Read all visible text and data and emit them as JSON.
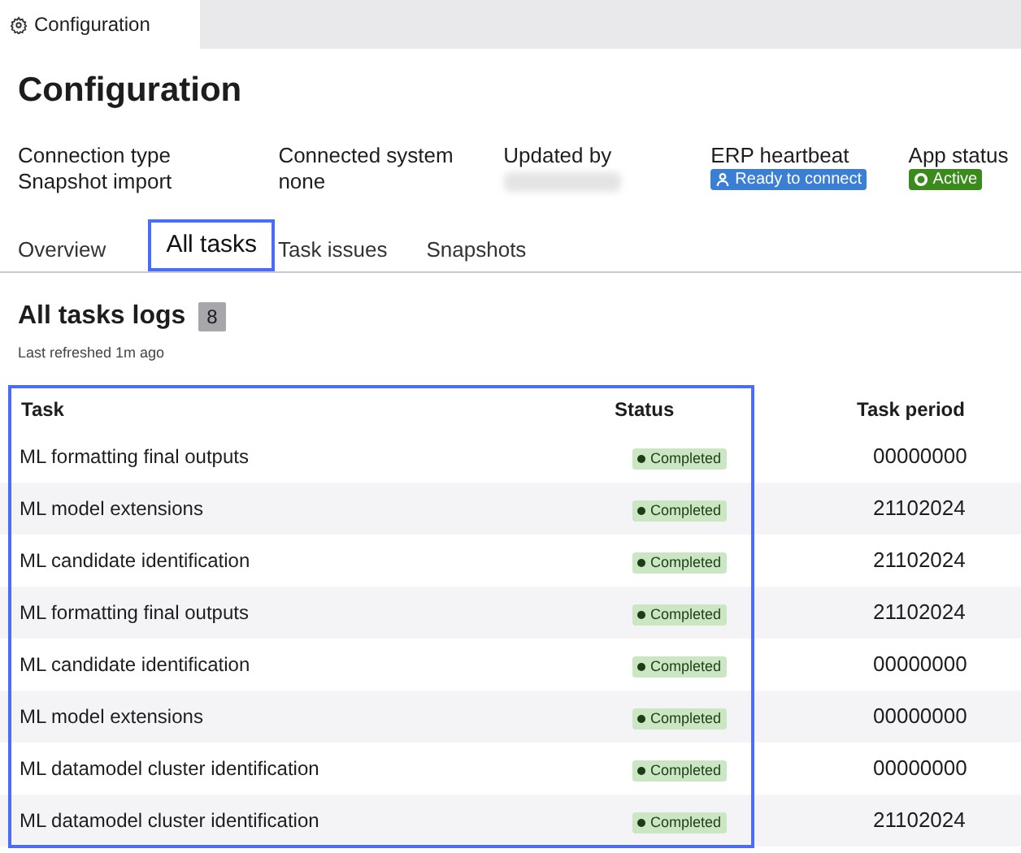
{
  "window_tab": {
    "title": "Configuration"
  },
  "title": "Configuration",
  "info": [
    {
      "kind": "text",
      "label": "Connection type",
      "value": "Snapshot import"
    },
    {
      "kind": "text",
      "label": "Connected system",
      "value": "none"
    },
    {
      "kind": "redacted",
      "label": "Updated by"
    },
    {
      "kind": "badge",
      "label": "ERP heartbeat",
      "value": "Ready to connect",
      "color": "#3b7fd4"
    },
    {
      "kind": "badge",
      "label": "App status",
      "value": "Active",
      "color": "#3a8a1c"
    }
  ],
  "tabs": [
    {
      "label": "Overview",
      "selected": false
    },
    {
      "label": "All tasks",
      "selected": true
    },
    {
      "label": "Task issues",
      "selected": false
    },
    {
      "label": "Snapshots",
      "selected": false
    }
  ],
  "section": {
    "title": "All tasks logs",
    "count": "8",
    "subtitle": "Last refreshed 1m ago"
  },
  "table": {
    "columns": [
      "Task",
      "Status",
      "Task period"
    ],
    "rows": [
      {
        "task": "ML formatting final outputs",
        "status": "Completed",
        "period": "00000000"
      },
      {
        "task": "ML model extensions",
        "status": "Completed",
        "period": "21102024"
      },
      {
        "task": "ML candidate identification",
        "status": "Completed",
        "period": "21102024"
      },
      {
        "task": "ML formatting final outputs",
        "status": "Completed",
        "period": "21102024"
      },
      {
        "task": "ML candidate identification",
        "status": "Completed",
        "period": "00000000"
      },
      {
        "task": "ML model extensions",
        "status": "Completed",
        "period": "00000000"
      },
      {
        "task": "ML datamodel cluster identification",
        "status": "Completed",
        "period": "00000000"
      },
      {
        "task": "ML datamodel cluster identification",
        "status": "Completed",
        "period": "21102024"
      }
    ]
  }
}
